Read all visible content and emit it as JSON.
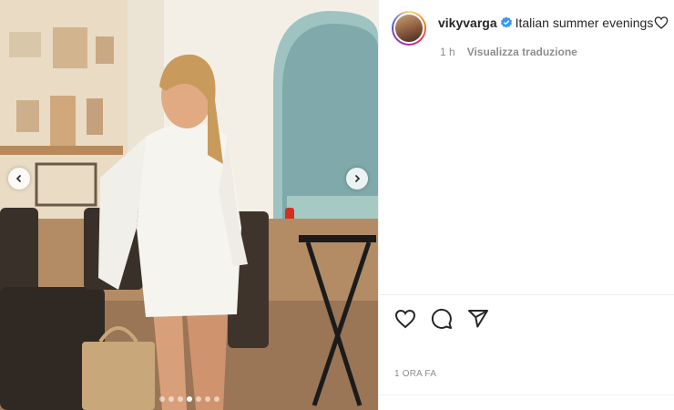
{
  "post": {
    "username": "vikyvarga",
    "caption": "Italian summer evenings",
    "time_ago": "1 h",
    "translate_label": "Visualizza traduzione",
    "timestamp": "1 ORA FA"
  },
  "carousel": {
    "total_slides": 7,
    "active_index": 3
  },
  "icons": {
    "verified": "verified-badge-icon",
    "caption_like": "heart-outline-icon",
    "like": "heart-outline-icon",
    "comment": "speech-bubble-icon",
    "share": "paper-plane-icon",
    "prev": "chevron-left-icon",
    "next": "chevron-right-icon"
  },
  "colors": {
    "verified_blue": "#3897f0",
    "text_primary": "#262626",
    "text_secondary": "#8e8e8e"
  }
}
